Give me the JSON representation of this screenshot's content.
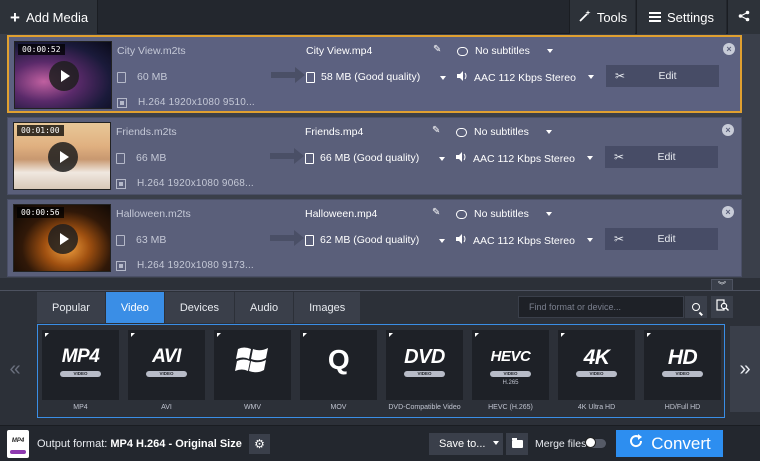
{
  "toolbar": {
    "add_media_label": "Add Media",
    "tools_label": "Tools",
    "settings_label": "Settings"
  },
  "files": [
    {
      "duration": "00:00:52",
      "source_name": "City View.m2ts",
      "source_size": "60 MB",
      "source_codec": "H.264 1920x1080 9510...",
      "output_name": "City View.mp4",
      "output_size": "58 MB (Good quality)",
      "subtitles": "No subtitles",
      "audio": "AAC 112 Kbps Stereo",
      "edit_label": "Edit"
    },
    {
      "duration": "00:01:00",
      "source_name": "Friends.m2ts",
      "source_size": "66 MB",
      "source_codec": "H.264 1920x1080 9068...",
      "output_name": "Friends.mp4",
      "output_size": "66 MB (Good quality)",
      "subtitles": "No subtitles",
      "audio": "AAC 112 Kbps Stereo",
      "edit_label": "Edit"
    },
    {
      "duration": "00:00:56",
      "source_name": "Halloween.m2ts",
      "source_size": "63 MB",
      "source_codec": "H.264 1920x1080 9173...",
      "output_name": "Halloween.mp4",
      "output_size": "62 MB (Good quality)",
      "subtitles": "No subtitles",
      "audio": "AAC 112 Kbps Stereo",
      "edit_label": "Edit"
    }
  ],
  "format_tabs": [
    "Popular",
    "Video",
    "Devices",
    "Audio",
    "Images"
  ],
  "active_tab": "Video",
  "search": {
    "placeholder": "Find format or device..."
  },
  "presets": [
    {
      "logo": "MP4",
      "tag": "VIDEO",
      "sub": "",
      "label": "MP4"
    },
    {
      "logo": "AVI",
      "tag": "VIDEO",
      "sub": "",
      "label": "AVI"
    },
    {
      "logo": "",
      "tag": "",
      "sub": "",
      "label": "WMV"
    },
    {
      "logo": "Q",
      "tag": "",
      "sub": "",
      "label": "MOV"
    },
    {
      "logo": "DVD",
      "tag": "VIDEO",
      "sub": "",
      "label": "DVD-Compatible Video"
    },
    {
      "logo": "HEVC",
      "tag": "VIDEO",
      "sub": "H.265",
      "label": "HEVC (H.265)"
    },
    {
      "logo": "4K",
      "tag": "VIDEO",
      "sub": "",
      "label": "4K Ultra HD"
    },
    {
      "logo": "HD",
      "tag": "VIDEO",
      "sub": "",
      "label": "HD/Full HD"
    }
  ],
  "bottom": {
    "output_format_prefix": "Output format:",
    "output_format_value": "MP4 H.264",
    "output_format_sep": "-",
    "output_format_size": "Original Size",
    "save_to_label": "Save to...",
    "merge_label": "Merge files",
    "convert_label": "Convert"
  },
  "colors": {
    "accent": "#2d8ef0",
    "selected_border": "#e0a030",
    "item_bg": "#5a5f7a"
  }
}
